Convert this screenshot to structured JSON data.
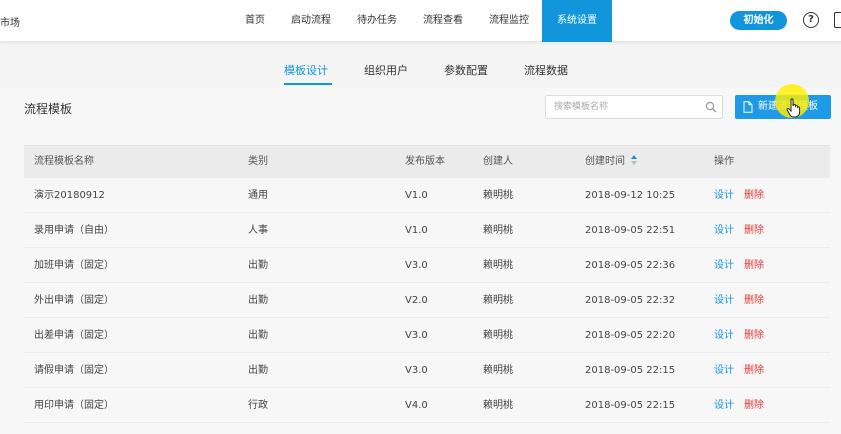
{
  "header": {
    "brand": "市场",
    "nav": [
      "首页",
      "启动流程",
      "待办任务",
      "流程查看",
      "流程监控",
      "系统设置"
    ],
    "active_nav": "系统设置",
    "init_label": "初始化",
    "help_glyph": "?"
  },
  "subtabs": [
    "模板设计",
    "组织用户",
    "参数配置",
    "流程数据"
  ],
  "panel": {
    "title": "流程模板",
    "search_placeholder": "搜索模板名称",
    "new_button": "新建流程模板"
  },
  "table": {
    "columns": [
      "流程模板名称",
      "类别",
      "发布版本",
      "创建人",
      "创建时间",
      "操作"
    ],
    "rows": [
      [
        "演示20180912",
        "通用",
        "V1.0",
        "赖明桃",
        "2018-09-12 10:25"
      ],
      [
        "录用申请（自由）",
        "人事",
        "V1.0",
        "赖明桃",
        "2018-09-05 22:51"
      ],
      [
        "加班申请（固定）",
        "出勤",
        "V3.0",
        "赖明桃",
        "2018-09-05 22:36"
      ],
      [
        "外出申请（固定）",
        "出勤",
        "V2.0",
        "赖明桃",
        "2018-09-05 22:32"
      ],
      [
        "出差申请（固定）",
        "出勤",
        "V3.0",
        "赖明桃",
        "2018-09-05 22:20"
      ],
      [
        "请假申请（固定）",
        "出勤",
        "V3.0",
        "赖明桃",
        "2018-09-05 22:15"
      ],
      [
        "用印申请（固定）",
        "行政",
        "V4.0",
        "赖明桃",
        "2018-09-05 22:15"
      ]
    ],
    "action_design": "设计",
    "action_delete": "删除"
  },
  "colors": {
    "accent": "#1296db",
    "delete": "#e53935",
    "cursor_highlight": "#ffee00"
  }
}
